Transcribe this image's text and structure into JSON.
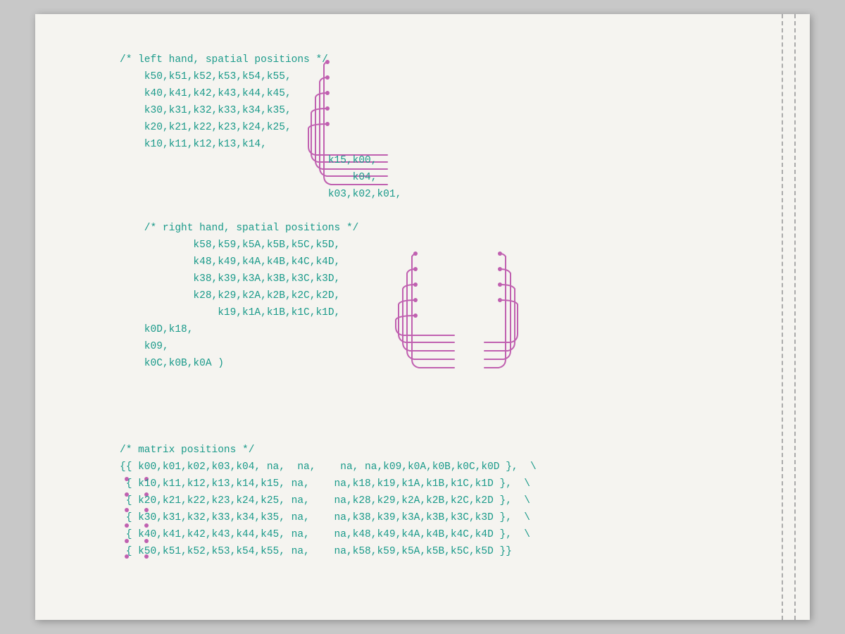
{
  "page": {
    "background": "#f5f4f0",
    "left_hand_comment": "/* left hand, spatial positions */",
    "left_hand_rows": [
      "k50,k51,k52,k53,k54,k55,",
      "k40,k41,k42,k43,k44,k45,",
      "k30,k31,k32,k33,k34,k35,",
      "k20,k21,k22,k23,k24,k25,",
      "k10,k11,k12,k13,k14,"
    ],
    "left_hand_tail": [
      "                              k15,k00,",
      "                                  k04,",
      "                              k03,k02,k01,"
    ],
    "right_hand_comment": "/* right hand, spatial positions */",
    "right_hand_rows": [
      "        k58,k59,k5A,k5B,k5C,k5D,",
      "        k48,k49,k4A,k4B,k4C,k4D,",
      "        k38,k39,k3A,k3B,k3C,k3D,",
      "        k28,k29,k2A,k2B,k2C,k2D,",
      "            k19,k1A,k1B,k1C,k1D,"
    ],
    "right_hand_tail": [
      "k0D,k18,",
      "k09,",
      "k0C,k0B,k0A )"
    ],
    "matrix_comment": "/* matrix positions */",
    "matrix_rows": [
      "{{ k00,k01,k02,k03,k04, na,  na,    na, na,k09,k0A,k0B,k0C,k0D },",
      " { k10,k11,k12,k13,k14,k15, na,    na,k18,k19,k1A,k1B,k1C,k1D },",
      " { k20,k21,k22,k23,k24,k25, na,    na,k28,k29,k2A,k2B,k2C,k2D },",
      " { k30,k31,k32,k33,k34,k35, na,    na,k38,k39,k3A,k3B,k3C,k3D },",
      " { k40,k41,k42,k43,k44,k45, na,    na,k48,k49,k4A,k4B,k4C,k4D },",
      " { k50,k51,k52,k53,k54,k55, na,    na,k58,k59,k5A,k5B,k5C,k5D }}"
    ]
  }
}
